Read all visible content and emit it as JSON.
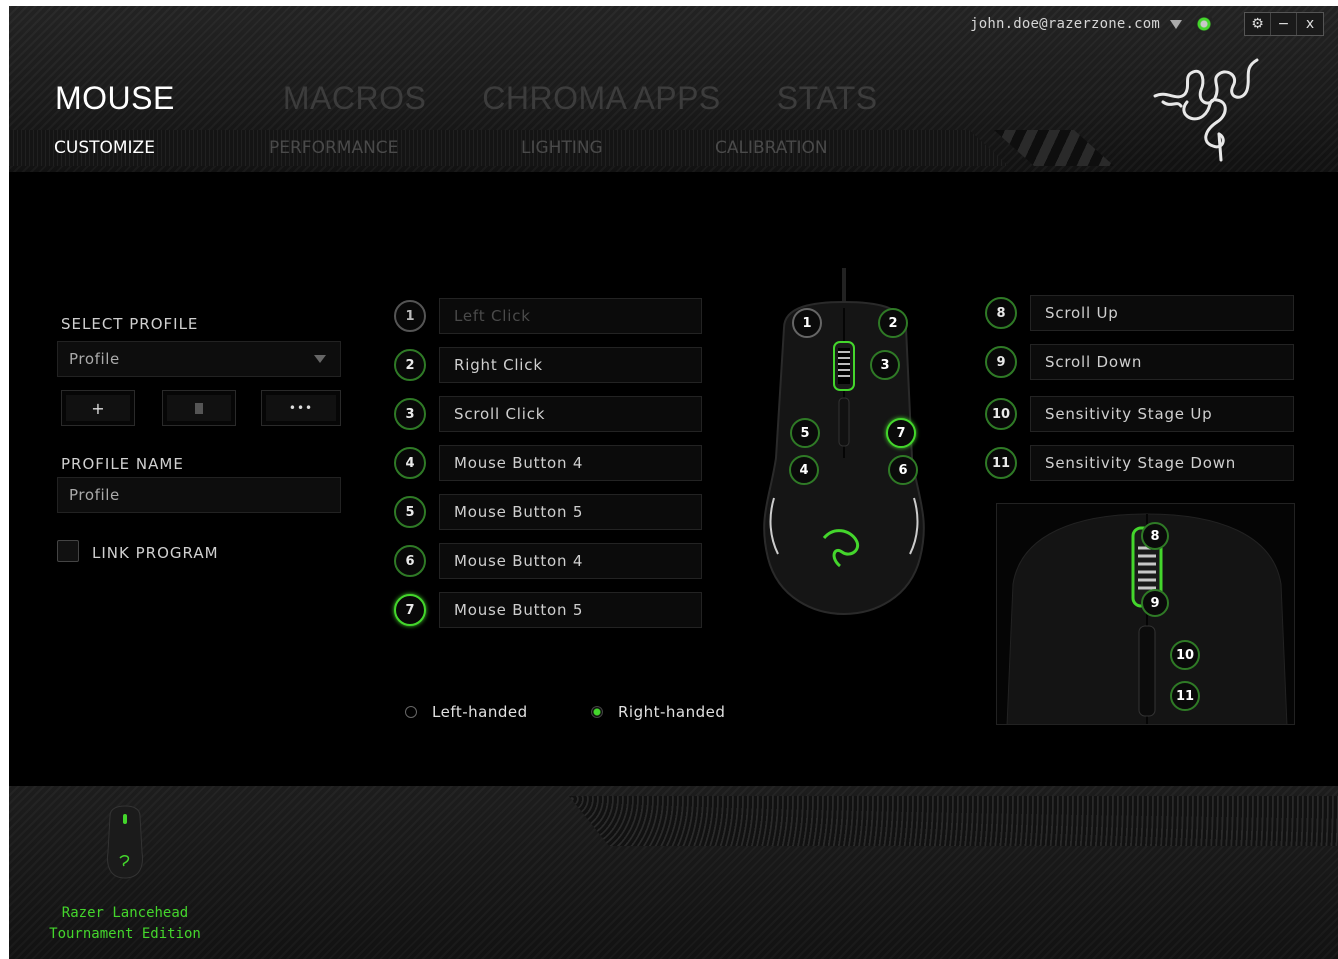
{
  "header": {
    "user_email": "john.doe@razerzone.com",
    "window_controls": [
      "⚙",
      "−",
      "x"
    ],
    "main_tabs": [
      {
        "label": "MOUSE",
        "active": true
      },
      {
        "label": "MACROS",
        "active": false
      },
      {
        "label": "CHROMA APPS",
        "active": false
      },
      {
        "label": "STATS",
        "active": false
      }
    ],
    "sub_tabs": [
      {
        "label": "CUSTOMIZE",
        "active": true
      },
      {
        "label": "PERFORMANCE",
        "active": false
      },
      {
        "label": "LIGHTING",
        "active": false
      },
      {
        "label": "CALIBRATION",
        "active": false
      }
    ],
    "logo_icon": "razer-snake-logo"
  },
  "profile": {
    "select_label": "SELECT PROFILE",
    "selected": "Profile",
    "add_icon": "+",
    "delete_icon": "trash-icon",
    "more_icon": "•••",
    "name_label": "PROFILE NAME",
    "name_value": "Profile",
    "link_program_label": "LINK PROGRAM",
    "link_program_checked": false
  },
  "buttons_left": [
    {
      "num": "1",
      "label": "Left Click"
    },
    {
      "num": "2",
      "label": "Right Click"
    },
    {
      "num": "3",
      "label": "Scroll Click"
    },
    {
      "num": "4",
      "label": "Mouse Button 4"
    },
    {
      "num": "5",
      "label": "Mouse Button 5"
    },
    {
      "num": "6",
      "label": "Mouse Button 4"
    },
    {
      "num": "7",
      "label": "Mouse Button 5"
    }
  ],
  "buttons_right": [
    {
      "num": "8",
      "label": "Scroll Up"
    },
    {
      "num": "9",
      "label": "Scroll Down"
    },
    {
      "num": "10",
      "label": "Sensitivity Stage Up"
    },
    {
      "num": "11",
      "label": "Sensitivity Stage Down"
    }
  ],
  "mouse_markers": [
    "1",
    "2",
    "3",
    "5",
    "7",
    "4",
    "6"
  ],
  "closeup_markers": [
    "8",
    "9",
    "10",
    "11"
  ],
  "handedness": {
    "left_label": "Left-handed",
    "right_label": "Right-handed",
    "selected": "right"
  },
  "device": {
    "name_line1": "Razer Lancehead",
    "name_line2": "Tournament Edition"
  },
  "colors": {
    "accent": "#44d62c",
    "background": "#000000",
    "inactive_tab": "#3c3c3c"
  }
}
